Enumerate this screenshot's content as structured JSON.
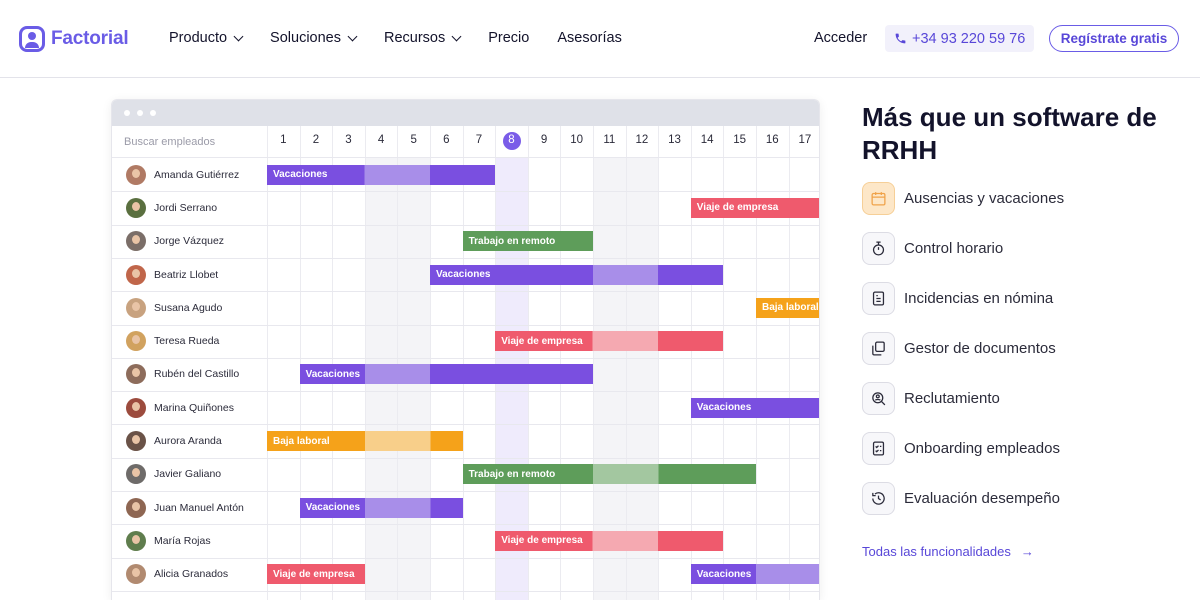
{
  "nav": {
    "logo": "Factorial",
    "menu": [
      {
        "label": "Producto",
        "dropdown": true
      },
      {
        "label": "Soluciones",
        "dropdown": true
      },
      {
        "label": "Recursos",
        "dropdown": true
      },
      {
        "label": "Precio",
        "dropdown": false
      },
      {
        "label": "Asesorías",
        "dropdown": false
      }
    ],
    "login": "Acceder",
    "phone": "+34 93 220 59 76",
    "register": "Regístrate gratis"
  },
  "calendar": {
    "search_placeholder": "Buscar empleados",
    "days": [
      1,
      2,
      3,
      4,
      5,
      6,
      7,
      8,
      9,
      10,
      11,
      12,
      13,
      14,
      15,
      16,
      17
    ],
    "today": 8,
    "weekend_days": [
      4,
      5,
      11,
      12
    ],
    "colors": {
      "Vacaciones": [
        "#7a4fe0",
        "#a88ee9"
      ],
      "Viaje de empresa": [
        "#ef5a6d",
        "#f5a9b1"
      ],
      "Trabajo en remoto": [
        "#5e9d5a",
        "#a3c7a0"
      ],
      "Baja laboral": [
        "#f5a21a",
        "#f8cf8a"
      ]
    },
    "employees": [
      {
        "name": "Amanda Gutiérrez",
        "avatar_color": "#b07a64",
        "bars": [
          {
            "type": "Vacaciones",
            "start": 1,
            "end": 7,
            "light": [
              4,
              5
            ]
          }
        ]
      },
      {
        "name": "Jordi Serrano",
        "avatar_color": "#5a6f3f",
        "bars": [
          {
            "type": "Viaje de empresa",
            "start": 14,
            "end": 17,
            "light": []
          }
        ]
      },
      {
        "name": "Jorge Vázquez",
        "avatar_color": "#7b6e68",
        "bars": [
          {
            "type": "Trabajo en remoto",
            "start": 7,
            "end": 10,
            "light": []
          }
        ]
      },
      {
        "name": "Beatriz Llobet",
        "avatar_color": "#c0664a",
        "bars": [
          {
            "type": "Vacaciones",
            "start": 6,
            "end": 14,
            "light": [
              11,
              12
            ]
          }
        ]
      },
      {
        "name": "Susana Agudo",
        "avatar_color": "#c8a27f",
        "bars": [
          {
            "type": "Baja laboral",
            "start": 16,
            "end": 17,
            "light": []
          }
        ]
      },
      {
        "name": "Teresa Rueda",
        "avatar_color": "#d1a25f",
        "bars": [
          {
            "type": "Viaje de empresa",
            "start": 8,
            "end": 14,
            "light": [
              11,
              12
            ]
          }
        ]
      },
      {
        "name": "Rubén del Castillo",
        "avatar_color": "#8d6c5b",
        "bars": [
          {
            "type": "Vacaciones",
            "start": 2,
            "end": 10,
            "light": [
              4,
              5
            ]
          }
        ]
      },
      {
        "name": "Marina Quiñones",
        "avatar_color": "#9c4b3d",
        "bars": [
          {
            "type": "Vacaciones",
            "start": 14,
            "end": 17,
            "light": []
          }
        ]
      },
      {
        "name": "Aurora Aranda",
        "avatar_color": "#6a5247",
        "bars": [
          {
            "type": "Baja laboral",
            "start": 1,
            "end": 6,
            "light": [
              4,
              5
            ]
          }
        ]
      },
      {
        "name": "Javier Galiano",
        "avatar_color": "#6e6b69",
        "bars": [
          {
            "type": "Trabajo en remoto",
            "start": 7,
            "end": 15,
            "light": [
              11,
              12
            ]
          }
        ]
      },
      {
        "name": "Juan Manuel Antón",
        "avatar_color": "#8e6652",
        "bars": [
          {
            "type": "Vacaciones",
            "start": 2,
            "end": 6,
            "light": [
              4,
              5
            ]
          }
        ]
      },
      {
        "name": "María Rojas",
        "avatar_color": "#5f7d4d",
        "bars": [
          {
            "type": "Viaje de empresa",
            "start": 8,
            "end": 14,
            "light": [
              11,
              12
            ]
          }
        ]
      },
      {
        "name": "Alicia Granados",
        "avatar_color": "#b18a70",
        "bars": [
          {
            "type": "Viaje de empresa",
            "start": 1,
            "end": 3,
            "light": []
          },
          {
            "type": "Vacaciones",
            "start": 14,
            "end": 17,
            "light": [
              16,
              17
            ]
          }
        ]
      }
    ]
  },
  "panel": {
    "heading": "Más que un software de RRHH",
    "features": [
      {
        "label": "Ausencias y vacaciones",
        "icon": "calendar-icon",
        "active": true
      },
      {
        "label": "Control horario",
        "icon": "stopwatch-icon",
        "active": false
      },
      {
        "label": "Incidencias en nómina",
        "icon": "payroll-icon",
        "active": false
      },
      {
        "label": "Gestor de documentos",
        "icon": "documents-icon",
        "active": false
      },
      {
        "label": "Reclutamiento",
        "icon": "recruitment-icon",
        "active": false
      },
      {
        "label": "Onboarding empleados",
        "icon": "checklist-icon",
        "active": false
      },
      {
        "label": "Evaluación desempeño",
        "icon": "performance-icon",
        "active": false
      }
    ],
    "all_link": "Todas las funcionalidades",
    "accent": "#6a5ce6"
  }
}
